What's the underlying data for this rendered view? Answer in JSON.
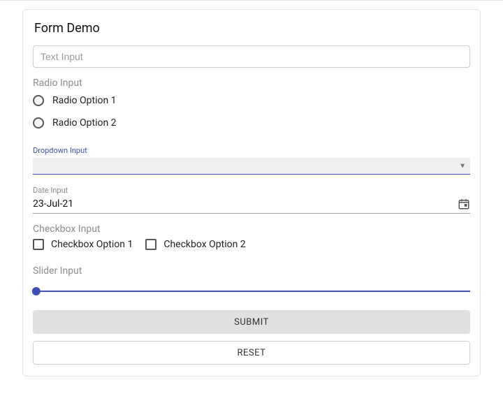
{
  "title": "Form Demo",
  "textInput": {
    "placeholder": "Text Input",
    "value": ""
  },
  "radio": {
    "label": "Radio Input",
    "options": [
      "Radio Option 1",
      "Radio Option 2"
    ]
  },
  "dropdown": {
    "label": "Dropdown Input",
    "value": ""
  },
  "date": {
    "label": "Date Input",
    "value": "23-Jul-21"
  },
  "checkbox": {
    "label": "Checkbox Input",
    "options": [
      "Checkbox Option 1",
      "Checkbox Option 2"
    ]
  },
  "slider": {
    "label": "Slider Input"
  },
  "buttons": {
    "submit": "Submit",
    "reset": "Reset"
  }
}
